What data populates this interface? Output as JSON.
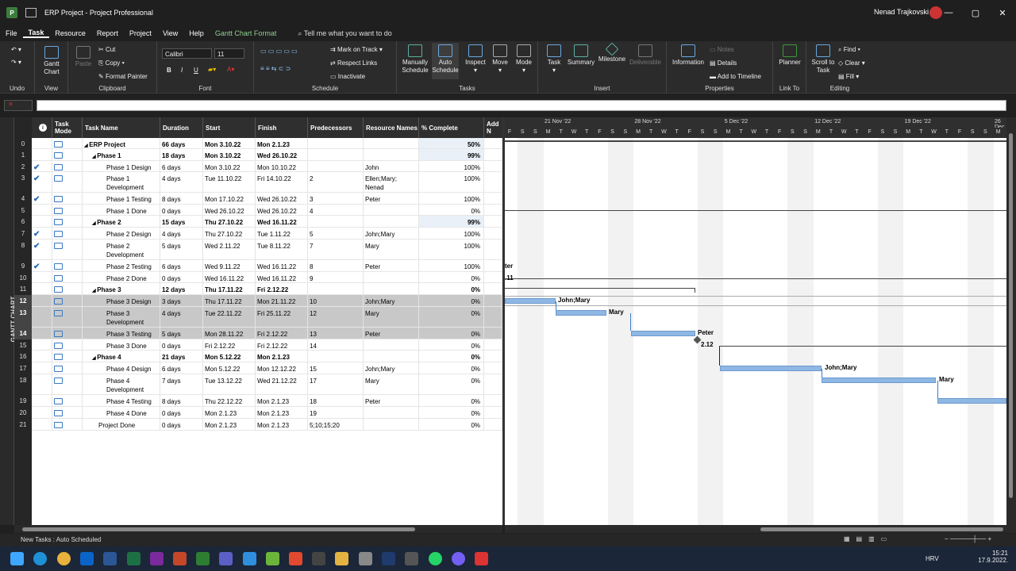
{
  "window": {
    "title": "ERP Project - Project Professional",
    "user": "Nenad Trajkovski",
    "min": "—",
    "max": "▢",
    "close": "✕"
  },
  "menu": {
    "items": [
      "File",
      "Task",
      "Resource",
      "Report",
      "Project",
      "View",
      "Help"
    ],
    "context_tab": "Gantt Chart Format",
    "tell_me": "Tell me what you want to do"
  },
  "ribbon": {
    "undo_label": "Undo",
    "view": {
      "gantt": "Gantt Chart",
      "label": "View"
    },
    "clipboard": {
      "paste": "Paste",
      "cut": "Cut",
      "copy": "Copy",
      "format_painter": "Format Painter",
      "label": "Clipboard"
    },
    "font": {
      "name": "Calibri",
      "size": "11",
      "label": "Font",
      "bold": "B",
      "italic": "I",
      "underline": "U"
    },
    "schedule": {
      "mark_on_track": "Mark on Track",
      "respect_links": "Respect Links",
      "inactivate": "Inactivate",
      "label": "Schedule"
    },
    "tasks": {
      "manually": "Manually Schedule",
      "auto": "Auto Schedule",
      "inspect": "Inspect",
      "move": "Move",
      "mode": "Mode",
      "label": "Tasks"
    },
    "insert": {
      "task": "Task",
      "summary": "Summary",
      "milestone": "Milestone",
      "deliverable": "Deliverable",
      "label": "Insert"
    },
    "properties": {
      "information": "Information",
      "notes": "Notes",
      "details": "Details",
      "add_timeline": "Add to Timeline",
      "label": "Properties"
    },
    "linkto": {
      "planner": "Planner",
      "label": "Link To"
    },
    "editing": {
      "scroll": "Scroll to Task",
      "find": "Find",
      "clear": "Clear",
      "fill": "Fill",
      "label": "Editing"
    }
  },
  "side_label": "GANTT CHART",
  "columns": {
    "info": "i",
    "mode": "Task Mode",
    "name": "Task Name",
    "duration": "Duration",
    "start": "Start",
    "finish": "Finish",
    "pred": "Predecessors",
    "res": "Resource Names",
    "pct": "% Complete",
    "add": "Add N"
  },
  "tasks": [
    {
      "id": "0",
      "check": "",
      "name": "ERP Project",
      "indent": 0,
      "summary": true,
      "duration": "66 days",
      "start": "Mon 3.10.22",
      "finish": "Mon 2.1.23",
      "pred": "",
      "res": "",
      "pct": "50%"
    },
    {
      "id": "1",
      "check": "",
      "name": "Phase 1",
      "indent": 1,
      "summary": true,
      "duration": "18 days",
      "start": "Mon 3.10.22",
      "finish": "Wed 26.10.22",
      "pred": "",
      "res": "",
      "pct": "99%"
    },
    {
      "id": "2",
      "check": "✔",
      "name": "Phase 1 Design",
      "indent": 2,
      "summary": false,
      "duration": "6 days",
      "start": "Mon 3.10.22",
      "finish": "Mon 10.10.22",
      "pred": "",
      "res": "John",
      "pct": "100%"
    },
    {
      "id": "3",
      "check": "✔",
      "name": "Phase 1 Development",
      "indent": 2,
      "summary": false,
      "duration": "4 days",
      "start": "Tue 11.10.22",
      "finish": "Fri 14.10.22",
      "pred": "2",
      "res": "Ellen;Mary; Nenad",
      "pct": "100%"
    },
    {
      "id": "4",
      "check": "✔",
      "name": "Phase 1 Testing",
      "indent": 2,
      "summary": false,
      "duration": "8 days",
      "start": "Mon 17.10.22",
      "finish": "Wed 26.10.22",
      "pred": "3",
      "res": "Peter",
      "pct": "100%"
    },
    {
      "id": "5",
      "check": "",
      "name": "Phase 1 Done",
      "indent": 2,
      "summary": false,
      "duration": "0 days",
      "start": "Wed 26.10.22",
      "finish": "Wed 26.10.22",
      "pred": "4",
      "res": "",
      "pct": "0%"
    },
    {
      "id": "6",
      "check": "",
      "name": "Phase 2",
      "indent": 1,
      "summary": true,
      "duration": "15 days",
      "start": "Thu 27.10.22",
      "finish": "Wed 16.11.22",
      "pred": "",
      "res": "",
      "pct": "99%"
    },
    {
      "id": "7",
      "check": "✔",
      "name": "Phase 2 Design",
      "indent": 2,
      "summary": false,
      "duration": "4 days",
      "start": "Thu 27.10.22",
      "finish": "Tue 1.11.22",
      "pred": "5",
      "res": "John;Mary",
      "pct": "100%"
    },
    {
      "id": "8",
      "check": "✔",
      "name": "Phase 2 Development",
      "indent": 2,
      "summary": false,
      "duration": "5 days",
      "start": "Wed 2.11.22",
      "finish": "Tue 8.11.22",
      "pred": "7",
      "res": "Mary",
      "pct": "100%"
    },
    {
      "id": "9",
      "check": "✔",
      "name": "Phase 2 Testing",
      "indent": 2,
      "summary": false,
      "duration": "6 days",
      "start": "Wed 9.11.22",
      "finish": "Wed 16.11.22",
      "pred": "8",
      "res": "Peter",
      "pct": "100%"
    },
    {
      "id": "10",
      "check": "",
      "name": "Phase 2 Done",
      "indent": 2,
      "summary": false,
      "duration": "0 days",
      "start": "Wed 16.11.22",
      "finish": "Wed 16.11.22",
      "pred": "9",
      "res": "",
      "pct": "0%"
    },
    {
      "id": "11",
      "check": "",
      "name": "Phase 3",
      "indent": 1,
      "summary": true,
      "duration": "12 days",
      "start": "Thu 17.11.22",
      "finish": "Fri 2.12.22",
      "pred": "",
      "res": "",
      "pct": "0%"
    },
    {
      "id": "12",
      "check": "",
      "name": "Phase 3 Design",
      "indent": 2,
      "summary": false,
      "duration": "3 days",
      "start": "Thu 17.11.22",
      "finish": "Mon 21.11.22",
      "pred": "10",
      "res": "John;Mary",
      "pct": "0%",
      "sel": true
    },
    {
      "id": "13",
      "check": "",
      "name": "Phase 3 Development",
      "indent": 2,
      "summary": false,
      "duration": "4 days",
      "start": "Tue 22.11.22",
      "finish": "Fri 25.11.22",
      "pred": "12",
      "res": "Mary",
      "pct": "0%",
      "sel": true
    },
    {
      "id": "14",
      "check": "",
      "name": "Phase 3 Testing",
      "indent": 2,
      "summary": false,
      "duration": "5 days",
      "start": "Mon 28.11.22",
      "finish": "Fri 2.12.22",
      "pred": "13",
      "res": "Peter",
      "pct": "0%",
      "sel": true
    },
    {
      "id": "15",
      "check": "",
      "name": "Phase 3 Done",
      "indent": 2,
      "summary": false,
      "duration": "0 days",
      "start": "Fri 2.12.22",
      "finish": "Fri 2.12.22",
      "pred": "14",
      "res": "",
      "pct": "0%"
    },
    {
      "id": "16",
      "check": "",
      "name": "Phase 4",
      "indent": 1,
      "summary": true,
      "duration": "21 days",
      "start": "Mon 5.12.22",
      "finish": "Mon 2.1.23",
      "pred": "",
      "res": "",
      "pct": "0%"
    },
    {
      "id": "17",
      "check": "",
      "name": "Phase 4 Design",
      "indent": 2,
      "summary": false,
      "duration": "6 days",
      "start": "Mon 5.12.22",
      "finish": "Mon 12.12.22",
      "pred": "15",
      "res": "John;Mary",
      "pct": "0%"
    },
    {
      "id": "18",
      "check": "",
      "name": "Phase 4 Development",
      "indent": 2,
      "summary": false,
      "duration": "7 days",
      "start": "Tue 13.12.22",
      "finish": "Wed 21.12.22",
      "pred": "17",
      "res": "Mary",
      "pct": "0%"
    },
    {
      "id": "19",
      "check": "",
      "name": "Phase 4 Testing",
      "indent": 2,
      "summary": false,
      "duration": "8 days",
      "start": "Thu 22.12.22",
      "finish": "Mon 2.1.23",
      "pred": "18",
      "res": "Peter",
      "pct": "0%"
    },
    {
      "id": "20",
      "check": "",
      "name": "Phase 4 Done",
      "indent": 2,
      "summary": false,
      "duration": "0 days",
      "start": "Mon 2.1.23",
      "finish": "Mon 2.1.23",
      "pred": "19",
      "res": "",
      "pct": "0%"
    },
    {
      "id": "21",
      "check": "",
      "name": "Project Done",
      "indent": 1,
      "summary": false,
      "duration": "0 days",
      "start": "Mon 2.1.23",
      "finish": "Mon 2.1.23",
      "pred": "5;10;15;20",
      "res": "",
      "pct": "0%"
    }
  ],
  "timescale": {
    "weeks": [
      "21 Nov '22",
      "28 Nov '22",
      "5 Dec '22",
      "12 Dec '22",
      "19 Dec '22",
      "26 Dec"
    ],
    "days": [
      "F",
      "S",
      "S",
      "M",
      "T",
      "W",
      "T",
      "F",
      "S",
      "S",
      "M",
      "T",
      "W",
      "T",
      "F",
      "S",
      "S",
      "M",
      "T",
      "W",
      "T",
      "F",
      "S",
      "S",
      "M",
      "T",
      "W",
      "T",
      "F",
      "S",
      "S",
      "M",
      "T",
      "W",
      "T",
      "F",
      "S",
      "S",
      "M"
    ]
  },
  "chart_labels": {
    "peter_partial": "ter",
    "date_partial": ".11",
    "p3design_res": "John;Mary",
    "p3dev_res": "Mary",
    "p3test_res": "Peter",
    "p3done_date": "2.12",
    "p4design_res": "John;Mary",
    "p4dev_res": "Mary"
  },
  "status": {
    "new_tasks": "New Tasks : Auto Scheduled"
  },
  "tray": {
    "lang": "HRV",
    "time": "15:21",
    "date": "17.9.2022."
  }
}
